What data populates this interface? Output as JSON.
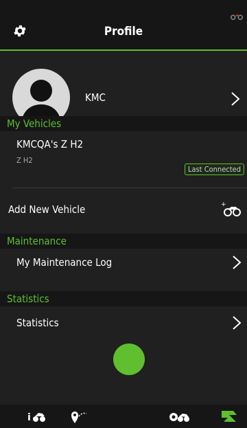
{
  "header": {
    "title": "Profile",
    "settings_icon": "gear-icon",
    "corner_icon": "motorcycle-icon"
  },
  "profile": {
    "name": "KMC"
  },
  "sections": {
    "vehicles": "My Vehicles",
    "maintenance": "Maintenance",
    "statistics": "Statistics"
  },
  "vehicle": {
    "name": "KMCQA's Z H2",
    "model": "Z H2",
    "badge": "Last Connected"
  },
  "add_vehicle": {
    "label": "Add New Vehicle"
  },
  "maintenance_log": {
    "label": "My Maintenance Log"
  },
  "statistics_row": {
    "label": "Statistics"
  },
  "bottom_nav": {
    "items": [
      "info-motorcycle-icon",
      "map-route-icon",
      "center-button",
      "motorcycle-settings-icon",
      "brand-logo-icon"
    ]
  },
  "colors": {
    "accent": "#5fbf2f",
    "background": "#202020",
    "band": "#161616"
  }
}
